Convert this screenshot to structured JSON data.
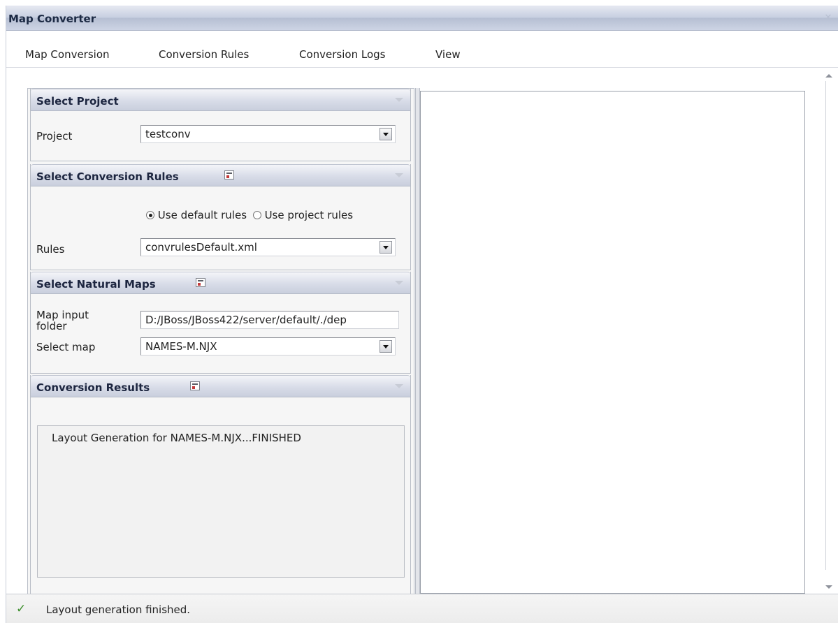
{
  "window": {
    "title": "Map Converter",
    "close_glyph": "✕"
  },
  "menu": {
    "items": [
      "Map Conversion",
      "Conversion Rules",
      "Conversion Logs",
      "View"
    ]
  },
  "panels": {
    "select_project": {
      "title": "Select Project",
      "project_label": "Project",
      "project_value": "testconv"
    },
    "select_rules": {
      "title": "Select Conversion Rules",
      "radio_default_label": "Use default rules",
      "radio_project_label": "Use project rules",
      "selected_radio": "default",
      "rules_label": "Rules",
      "rules_value": "convrulesDefault.xml"
    },
    "select_maps": {
      "title": "Select Natural Maps",
      "input_folder_label": "Map input folder",
      "input_folder_value": "D:/JBoss/JBoss422/server/default/./dep",
      "select_map_label": "Select map",
      "select_map_value": "NAMES-M.NJX"
    },
    "results": {
      "title": "Conversion Results",
      "lines": [
        "Layout Generation for NAMES-M.NJX...FINISHED"
      ]
    }
  },
  "status": {
    "icon": "check-icon",
    "text": "Layout generation finished."
  },
  "colors": {
    "titlebar": "#c7cfe1",
    "panel_header": "#d8dce8",
    "status_ok": "#3c8f2c"
  }
}
